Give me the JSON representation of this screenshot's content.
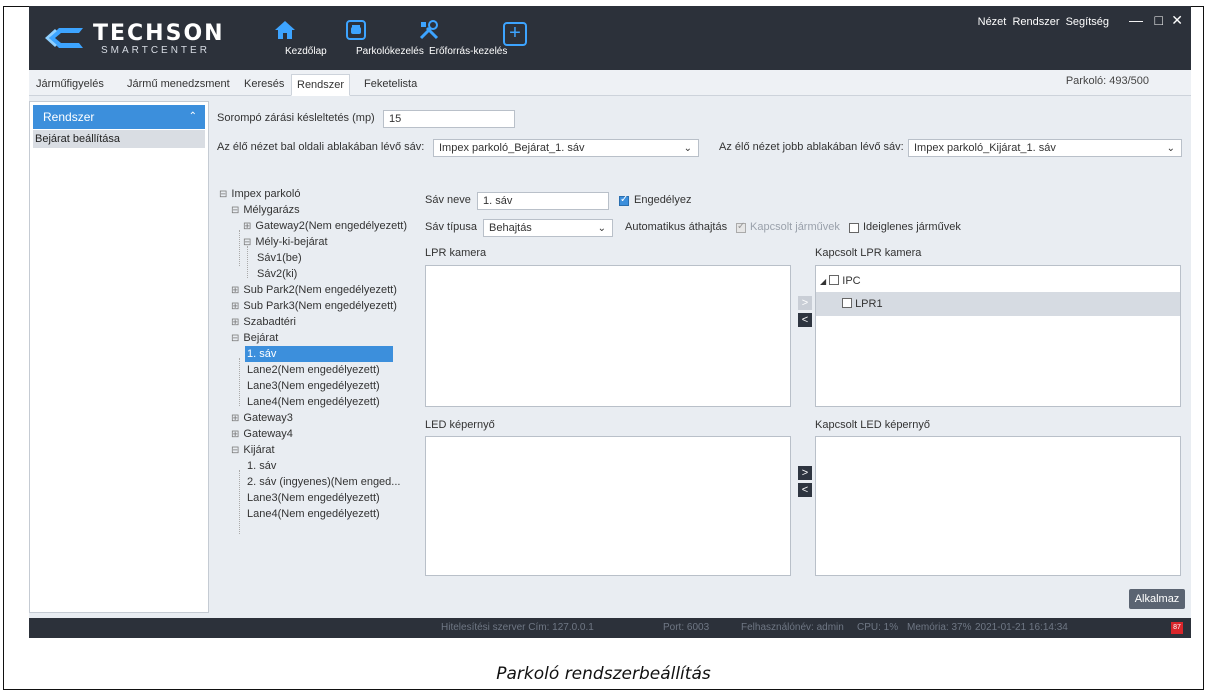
{
  "app": {
    "logo_main": "TECHSON",
    "logo_sub": "SMARTCENTER",
    "nav": [
      "Kezdőlap",
      "Parkolókezelés",
      "Erőforrás-kezelés"
    ],
    "add_button": "+",
    "top_menu": [
      "Nézet",
      "Rendszer",
      "Segítség"
    ],
    "win_controls": [
      "—",
      "□",
      "✕"
    ]
  },
  "subtabs": {
    "items": [
      "Járműfigyelés",
      "Jármű menedzsment",
      "Keresés",
      "Rendszer",
      "Feketelista"
    ],
    "active_index": 3,
    "parking_count": "Parkoló: 493/500"
  },
  "sidebar": {
    "header": "Rendszer",
    "item": "Bejárat beállítása"
  },
  "settings": {
    "barrier_label": "Sorompó zárási késleltetés (mp)",
    "barrier_value": "15",
    "left_lane_label": "Az élő nézet bal oldali ablakában lévő sáv:",
    "left_lane_value": "Impex parkoló_Bejárat_1. sáv",
    "right_lane_label": "Az élő nézet jobb ablakában lévő sáv:",
    "right_lane_value": "Impex parkoló_Kijárat_1. sáv",
    "lane_name_label": "Sáv neve",
    "lane_name_value": "1. sáv",
    "enable_label": "Engedélyez",
    "lane_type_label": "Sáv típusa",
    "lane_type_value": "Behajtás",
    "auto_pass_label": "Automatikus áthajtás",
    "linked_vehicles_label": "Kapcsolt járművek",
    "temp_vehicles_label": "Ideiglenes járművek",
    "lpr_camera_label": "LPR kamera",
    "linked_lpr_label": "Kapcsolt LPR kamera",
    "led_label": "LED képernyő",
    "linked_led_label": "Kapcsolt LED képernyő",
    "ipc_label": "IPC",
    "lpr1_label": "LPR1",
    "apply_label": "Alkalmaz"
  },
  "tree": [
    "Impex parkoló",
    "Mélygarázs",
    "Gateway2(Nem engedélyezett)",
    "Mély-ki-bejárat",
    "Sáv1(be)",
    "Sáv2(ki)",
    "Sub Park2(Nem engedélyezett)",
    "Sub Park3(Nem engedélyezett)",
    "Szabadtéri",
    "Bejárat",
    "1. sáv",
    "Lane2(Nem engedélyezett)",
    "Lane3(Nem engedélyezett)",
    "Lane4(Nem engedélyezett)",
    "Gateway3",
    "Gateway4",
    "Kijárat",
    "1. sáv",
    "2. sáv (ingyenes)(Nem enged...",
    "Lane3(Nem engedélyezett)",
    "Lane4(Nem engedélyezett)"
  ],
  "statusbar": {
    "server": "Hitelesítési szerver Cím: 127.0.0.1",
    "port": "Port: 6003",
    "user": "Felhasználónév: admin",
    "cpu": "CPU: 1%",
    "memory": "Memória: 37%",
    "datetime": "2021-01-21 16:14:34",
    "alarm": "87"
  },
  "caption": "Parkoló rendszerbeállítás"
}
